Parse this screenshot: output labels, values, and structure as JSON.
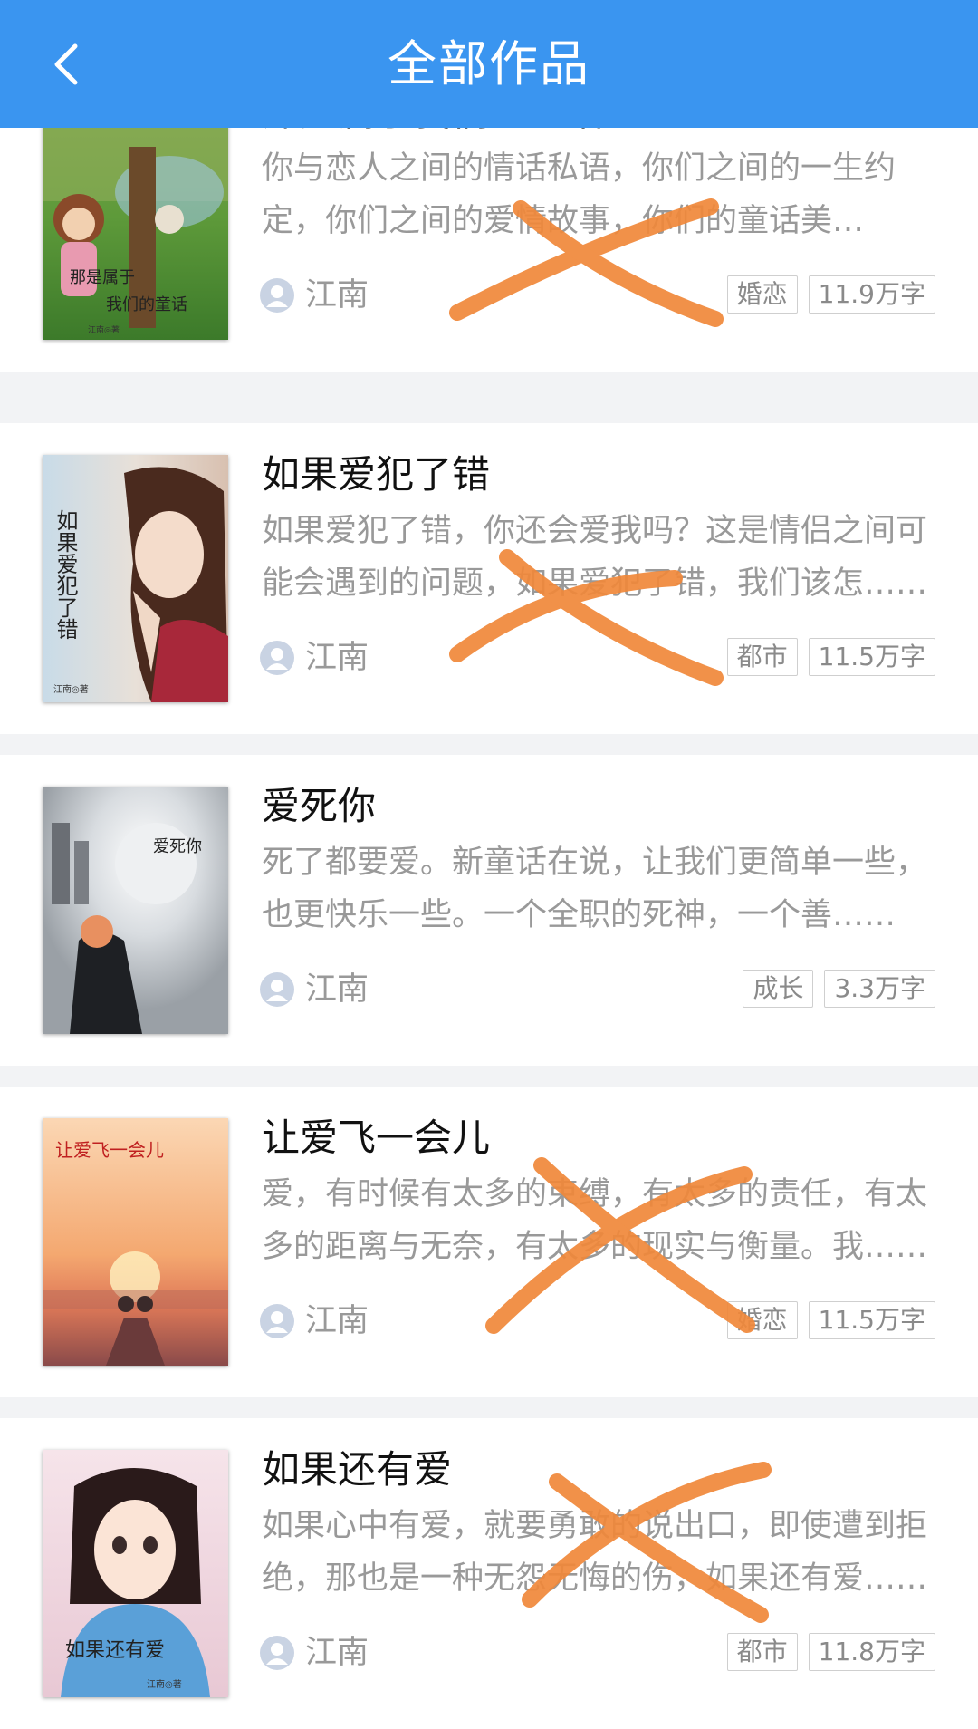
{
  "header": {
    "title": "全部作品"
  },
  "books": [
    {
      "title": "那是属于我们的童话",
      "description": "你与恋人之间的情话私语，你们之间的一生约定，你们之间的爱情故事，你们的童话美好，……",
      "author": "江南",
      "category": "婚恋",
      "word_count": "11.9万字",
      "cover_text": [
        "那是属于",
        "我们的童话",
        "江南◎著"
      ]
    },
    {
      "title": "如果爱犯了错",
      "description": "如果爱犯了错，你还会爱我吗？这是情侣之间可能会遇到的问题，如果爱犯了错，我们该怎……",
      "author": "江南",
      "category": "都市",
      "word_count": "11.5万字",
      "cover_text": [
        "如果爱犯了错",
        "江南◎著"
      ]
    },
    {
      "title": "爱死你",
      "description": "死了都要爱。新童话在说，让我们更简单一些，也更快乐一些。一个全职的死神，一个善……",
      "author": "江南",
      "category": "成长",
      "word_count": "3.3万字",
      "cover_text": [
        "爱死你"
      ]
    },
    {
      "title": "让爱飞一会儿",
      "description": "爱，有时候有太多的束缚，有太多的责任，有太多的距离与无奈，有太多的现实与衡量。我……",
      "author": "江南",
      "category": "婚恋",
      "word_count": "11.5万字",
      "cover_text": [
        "让爱飞一会儿"
      ]
    },
    {
      "title": "如果还有爱",
      "description": "如果心中有爱，就要勇敢的说出口，即使遭到拒绝，那也是一种无怨无悔的伤，如果还有爱……",
      "author": "江南",
      "category": "都市",
      "word_count": "11.8万字",
      "cover_text": [
        "如果还有爱",
        "江南◎著"
      ]
    }
  ],
  "colors": {
    "header_bg": "#3a95f0",
    "annotation_stroke": "#f0883a"
  },
  "icons": [
    "back-arrow-icon",
    "user-avatar-icon"
  ]
}
